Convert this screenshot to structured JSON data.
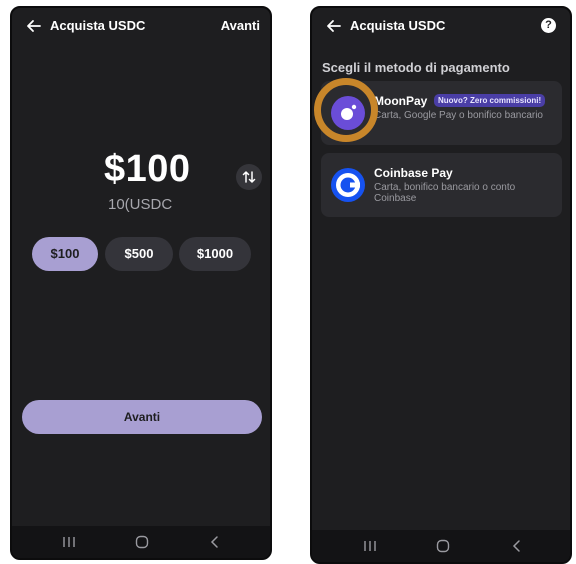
{
  "left_screen": {
    "title": "Acquista USDC",
    "action": "Avanti",
    "amount": "$100",
    "amount_converted": "10(USDC",
    "presets": [
      "$100",
      "$500",
      "$1000"
    ],
    "selected_preset": "$100",
    "continue_label": "Avanti",
    "icons": [
      "back-arrow-icon",
      "swap-icon",
      "recents-icon",
      "home-icon",
      "back-icon"
    ]
  },
  "right_screen": {
    "title": "Acquista USDC",
    "section_title": "Scegli il metodo di pagamento",
    "providers": [
      {
        "name": "MoonPay",
        "badge": "Nuovo? Zero commissioni!",
        "description": "Carta, Google Pay o bonifico bancario",
        "logo": "moonpay-logo"
      },
      {
        "name": "Coinbase Pay",
        "description": "Carta, bonifico bancario o conto Coinbase",
        "logo": "coinbase-logo"
      }
    ],
    "icons": [
      "back-arrow-icon",
      "help-icon",
      "recents-icon",
      "home-icon",
      "back-icon"
    ]
  },
  "colors": {
    "background": "#1e1e20",
    "accent": "#a89fd2",
    "chip": "#34343a",
    "card": "#2b2b2f",
    "badge": "#4a3ea6",
    "highlight": "#c8862a",
    "moonpay": "#6a4dd8",
    "coinbase": "#1652f0"
  }
}
